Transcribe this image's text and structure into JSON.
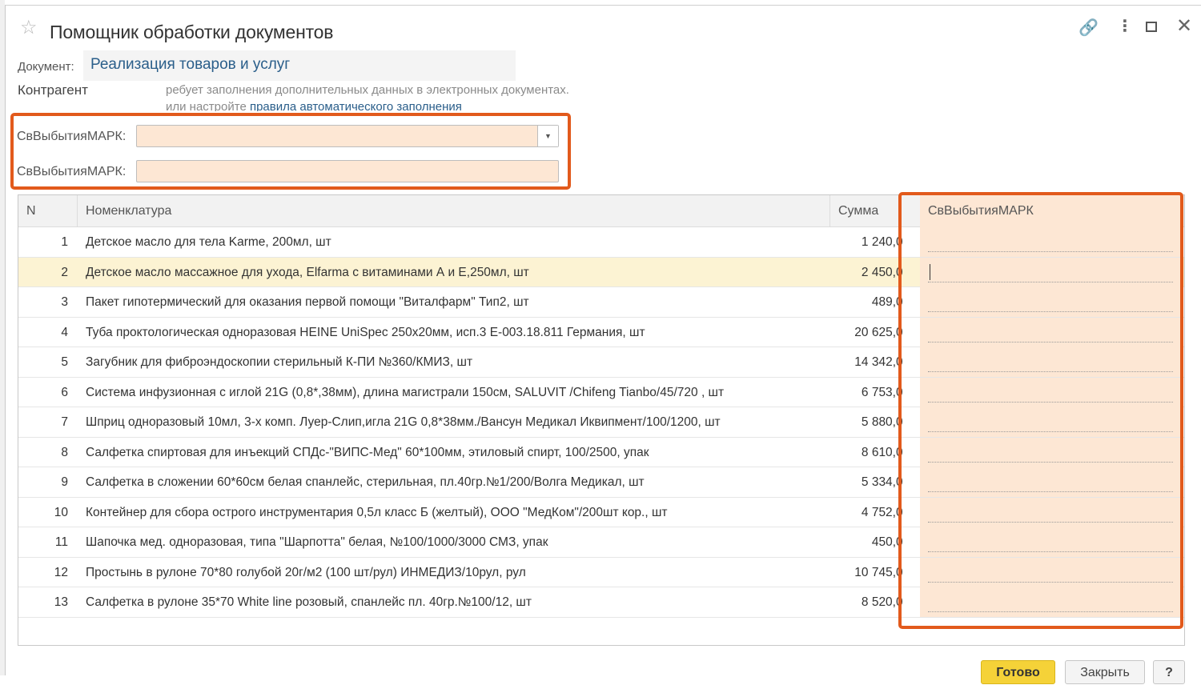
{
  "window": {
    "title": "Помощник обработки документов",
    "icons": [
      "star-icon",
      "link-icon",
      "more-icon",
      "maximize-icon",
      "close-icon"
    ]
  },
  "document": {
    "label": "Документ:",
    "value": "Реализация товаров и услуг"
  },
  "contractor": {
    "label": "Контрагент",
    "hint_line1": "ребует заполнения дополнительных данных в электронных документах.",
    "hint_line2_prefix": "или настройте ",
    "hint_line2_link": "правила автоматического заполнения"
  },
  "fields": [
    {
      "label": "СвВыбытияМАРК:",
      "value": ""
    },
    {
      "label": "СвВыбытияМАРК:",
      "value": ""
    }
  ],
  "table": {
    "columns": {
      "n": "N",
      "nomenclature": "Номенклатура",
      "sum": "Сумма",
      "mark": "СвВыбытияМАРК"
    },
    "rows": [
      {
        "n": "1",
        "name": "Детское масло для тела Karme, 200мл, шт",
        "sum": "1 240,",
        "frac": "0"
      },
      {
        "n": "2",
        "name": "Детское масло массажное для ухода, Elfarma с витаминами А и Е,250мл, шт",
        "sum": "2 450,",
        "frac": "0"
      },
      {
        "n": "3",
        "name": "Пакет гипотермический для оказания первой помощи \"Виталфарм\" Тип2, шт",
        "sum": "489,",
        "frac": "0"
      },
      {
        "n": "4",
        "name": "Туба проктологическая одноразовая HEINE UniSpec 250х20мм, исп.3 Е-003.18.811 Германия, шт",
        "sum": "20 625,",
        "frac": "0"
      },
      {
        "n": "5",
        "name": "Загубник для фиброэндоскопии стерильный К-ПИ №360/КМИЗ, шт",
        "sum": "14 342,",
        "frac": "0"
      },
      {
        "n": "6",
        "name": "Система инфузионная с иглой 21G (0,8*,38мм), длина магистрали 150см, SALUVIT /Chifeng Tianbo/45/720 , шт",
        "sum": "6 753,",
        "frac": "0"
      },
      {
        "n": "7",
        "name": "Шприц одноразовый 10мл, 3-х комп. Луер-Слип,игла 21G 0,8*38мм./Вансун Медикал Иквипмент/100/1200, шт",
        "sum": "5 880,",
        "frac": "0"
      },
      {
        "n": "8",
        "name": "Салфетка спиртовая для инъекций СПДс-\"ВИПС-Мед\" 60*100мм, этиловый спирт, 100/2500, упак",
        "sum": "8 610,",
        "frac": "0"
      },
      {
        "n": "9",
        "name": "Салфетка в сложении 60*60см белая спанлейс, стерильная, пл.40гр.№1/200/Волга Медикал, шт",
        "sum": "5 334,",
        "frac": "0"
      },
      {
        "n": "10",
        "name": "Контейнер для сбора острого инструментария 0,5л класс Б (желтый), ООО \"МедКом\"/200шт кор., шт",
        "sum": "4 752,",
        "frac": "0"
      },
      {
        "n": "11",
        "name": "Шапочка мед. одноразовая, типа \"Шарпотта\" белая, №100/1000/3000 СМЗ, упак",
        "sum": "450,",
        "frac": "0"
      },
      {
        "n": "12",
        "name": "Простынь в рулоне 70*80  голубой 20г/м2 (100 шт/рул) ИНМЕДИЗ/10рул, рул",
        "sum": "10 745,",
        "frac": "0"
      },
      {
        "n": "13",
        "name": "Салфетка в рулоне 35*70 White line розовый, спанлейс пл. 40гр.№100/12, шт",
        "sum": "8 520,",
        "frac": "0"
      }
    ],
    "selected_row": "2"
  },
  "buttons": {
    "ok": "Готово",
    "close": "Закрыть",
    "help": "?"
  },
  "colors": {
    "highlight_border": "#e25a1c",
    "input_bg": "#fde7d4",
    "selected_row": "#fcf3d3",
    "ok_button": "#f5d238",
    "link": "#2a5e8a"
  }
}
